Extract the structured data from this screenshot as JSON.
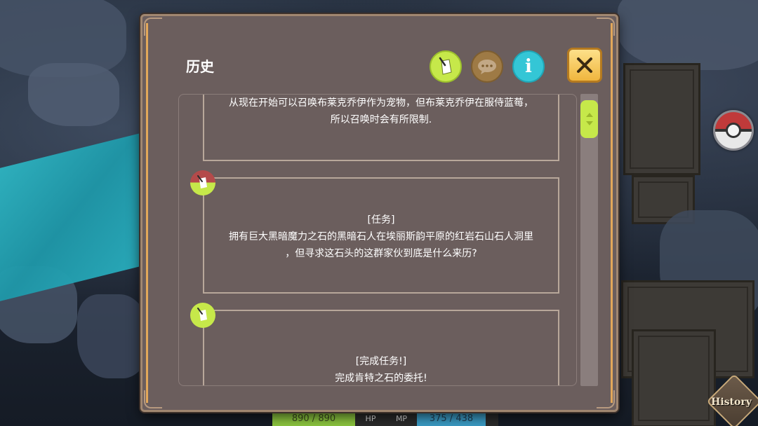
{
  "dialog": {
    "title": "历史",
    "tabs": [
      {
        "name": "quest",
        "icon": "quest-paper-icon",
        "color": "#c6e84a"
      },
      {
        "name": "chat",
        "icon": "chat-bubble-icon",
        "color": "#9e7a45"
      },
      {
        "name": "info",
        "icon": "info-icon",
        "label": "i",
        "color": "#34c6d6"
      }
    ],
    "close_icon": "close-icon"
  },
  "entries": [
    {
      "text": "从现在开始可以召唤布莱克乔伊作为宠物，但布莱克乔伊在服侍蓝莓，\n所以召唤时会有所限制.",
      "marker": "none"
    },
    {
      "text": "[任务]\n拥有巨大黑暗魔力之石的黑暗石人在埃丽斯韵平原的红岩石山石人洞里\n，但寻求这石头的这群家伙到底是什么来历?",
      "marker": "quest-red-green"
    },
    {
      "text": "[完成任务!]\n完成肯特之石的委托!",
      "marker": "quest-green"
    }
  ],
  "hud": {
    "hp_value": "890 / 890",
    "hp_label": "HP",
    "mp_label": "MP",
    "mp_value": "375 / 438",
    "hp_fraction": 1.0,
    "mp_fraction": 0.856
  },
  "side": {
    "pokeball_icon": "pokeball-icon",
    "history_label": "History"
  }
}
